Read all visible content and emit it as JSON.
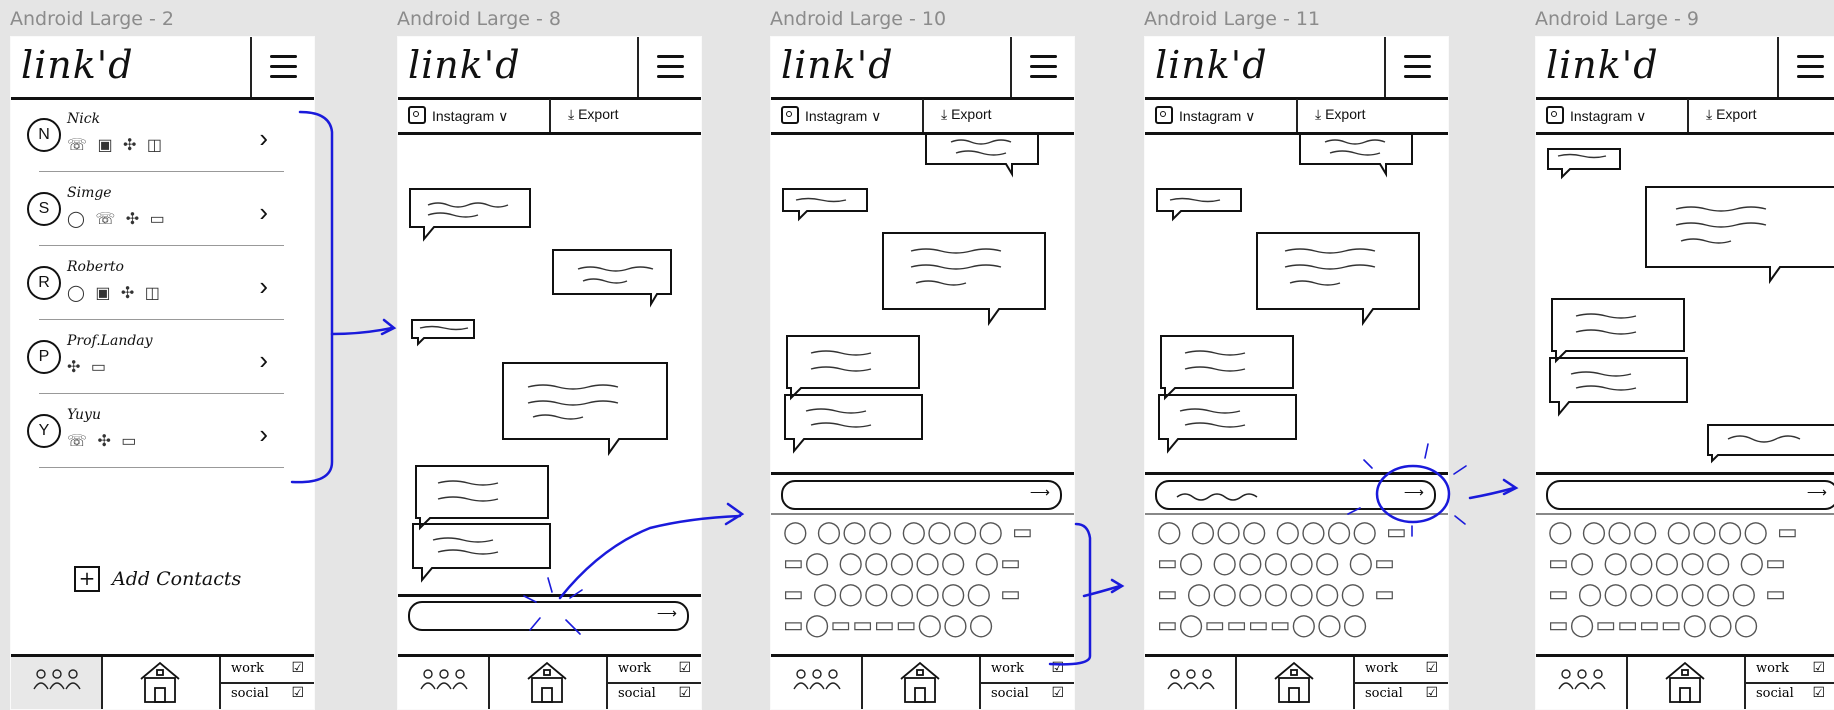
{
  "frames": [
    {
      "label": "Android Large - 2"
    },
    {
      "label": "Android Large - 8"
    },
    {
      "label": "Android Large - 10"
    },
    {
      "label": "Android Large - 11"
    },
    {
      "label": "Android Large - 9"
    }
  ],
  "app": {
    "logo": "link'd",
    "source_selector": "Instagram",
    "export_label": "Export",
    "send_icon": "arrow-right",
    "nav_work": "work",
    "nav_social": "social"
  },
  "contacts": [
    {
      "initial": "N",
      "name": "Nick",
      "icons": "☏ ▣ ✣ ◫"
    },
    {
      "initial": "S",
      "name": "Simge",
      "icons": "◯ ☏ ✣ ▭"
    },
    {
      "initial": "R",
      "name": "Roberto",
      "icons": "◯ ▣ ✣ ◫"
    },
    {
      "initial": "P",
      "name": "Prof.Landay",
      "icons": "✣ ▭"
    },
    {
      "initial": "Y",
      "name": "Yuyu",
      "icons": "☏ ✣ ▭"
    }
  ],
  "add_contacts": "Add Contacts",
  "annotation_color": "#1a1adb",
  "accent_color": "#111111"
}
